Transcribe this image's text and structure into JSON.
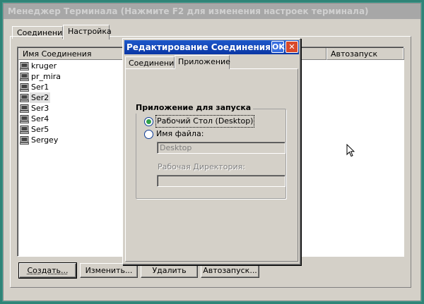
{
  "main_window": {
    "title": "Менеджер Терминала (Нажмите F2 для изменения настроек терминала)",
    "tabs": [
      {
        "label": "Соединения",
        "active": false
      },
      {
        "label": "Настройка",
        "active": true
      }
    ],
    "list": {
      "columns": [
        {
          "label": "Имя Соединения"
        },
        {
          "label": "Автозапуск"
        }
      ],
      "items": [
        {
          "name": "kruger",
          "selected": false,
          "icon": "terminal-icon"
        },
        {
          "name": "pr_mira",
          "selected": false,
          "icon": "terminal-icon"
        },
        {
          "name": "Ser1",
          "selected": false,
          "icon": "terminal-icon"
        },
        {
          "name": "Ser2",
          "selected": true,
          "icon": "terminal-icon"
        },
        {
          "name": "Ser3",
          "selected": false,
          "icon": "terminal-icon"
        },
        {
          "name": "Ser4",
          "selected": false,
          "icon": "terminal-icon"
        },
        {
          "name": "Ser5",
          "selected": false,
          "icon": "terminal-icon"
        },
        {
          "name": "Sergey",
          "selected": false,
          "icon": "terminal-icon"
        }
      ]
    },
    "buttons": {
      "create": "Создать...",
      "edit": "Изменить...",
      "delete": "Удалить",
      "autostart": "Автозапуск..."
    }
  },
  "dialog": {
    "title": "Редактирование Соединения",
    "ok_label": "OK",
    "close_label": "✕",
    "tabs": [
      {
        "label": "Соединение",
        "active": false
      },
      {
        "label": "Приложение",
        "active": true
      }
    ],
    "group_title": "Приложение для запуска",
    "options": [
      {
        "label": "Рабочий Стол (Desktop)",
        "checked": true
      },
      {
        "label": "Имя файла:",
        "checked": false
      }
    ],
    "filename_value": "Desktop",
    "workdir_label": "Рабочая Директория:",
    "workdir_value": ""
  },
  "colors": {
    "desktop": "#3f9a8c",
    "dialog_title": "#0a36a4",
    "radio_dot": "#31a049"
  }
}
